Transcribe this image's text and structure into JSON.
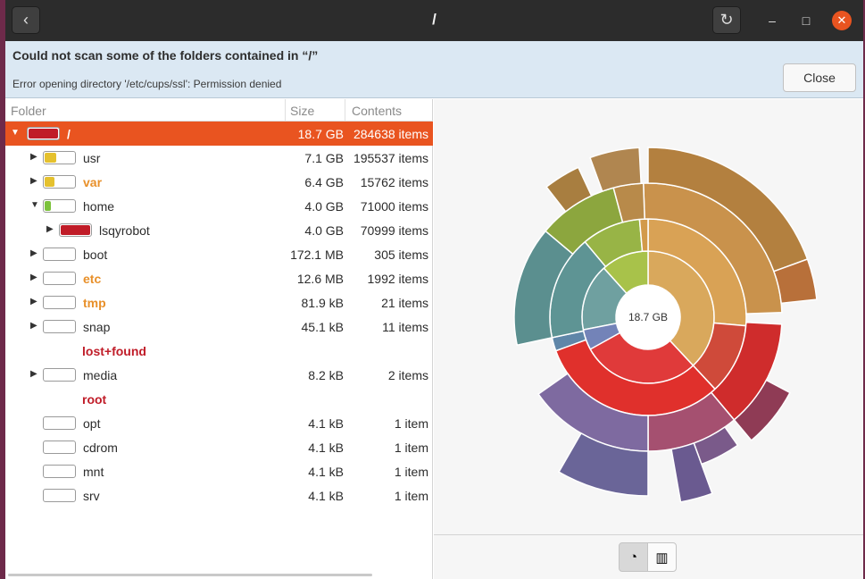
{
  "window": {
    "title": "/",
    "back_icon": "chevron-left-icon",
    "refresh_icon": "refresh-icon"
  },
  "infobar": {
    "title": "Could not scan some of the folders contained in “/”",
    "message": "Error opening directory '/etc/cups/ssl': Permission denied",
    "close_label": "Close"
  },
  "columns": {
    "folder": "Folder",
    "size": "Size",
    "contents": "Contents"
  },
  "rows": [
    {
      "name": "/",
      "size": "18.7 GB",
      "contents": "284638 items",
      "usage": 1.0,
      "color": "#c01c28"
    },
    {
      "name": "usr",
      "size": "7.1 GB",
      "contents": "195537 items",
      "usage": 0.38,
      "color": "#e5c12e"
    },
    {
      "name": "var",
      "size": "6.4 GB",
      "contents": "15762 items",
      "usage": 0.34,
      "color": "#e5c12e"
    },
    {
      "name": "home",
      "size": "4.0 GB",
      "contents": "71000 items",
      "usage": 0.21,
      "color": "#7cc23c"
    },
    {
      "name": "lsqyrobot",
      "size": "4.0 GB",
      "contents": "70999 items",
      "usage": 1.0,
      "color": "#c01c28"
    },
    {
      "name": "boot",
      "size": "172.1 MB",
      "contents": "305 items",
      "usage": 0.0,
      "color": "#7cc23c"
    },
    {
      "name": "etc",
      "size": "12.6 MB",
      "contents": "1992 items",
      "usage": 0.0,
      "color": "#7cc23c"
    },
    {
      "name": "tmp",
      "size": "81.9 kB",
      "contents": "21 items",
      "usage": 0.0,
      "color": "#7cc23c"
    },
    {
      "name": "snap",
      "size": "45.1 kB",
      "contents": "11 items",
      "usage": 0.0,
      "color": "#7cc23c"
    },
    {
      "name": "lost+found",
      "size": "",
      "contents": "",
      "usage": 0.0,
      "color": ""
    },
    {
      "name": "media",
      "size": "8.2 kB",
      "contents": "2 items",
      "usage": 0.0,
      "color": "#7cc23c"
    },
    {
      "name": "root",
      "size": "",
      "contents": "",
      "usage": 0.0,
      "color": ""
    },
    {
      "name": "opt",
      "size": "4.1 kB",
      "contents": "1 item",
      "usage": 0.0,
      "color": "#7cc23c"
    },
    {
      "name": "cdrom",
      "size": "4.1 kB",
      "contents": "1 item",
      "usage": 0.0,
      "color": "#7cc23c"
    },
    {
      "name": "mnt",
      "size": "4.1 kB",
      "contents": "1 item",
      "usage": 0.0,
      "color": "#7cc23c"
    },
    {
      "name": "srv",
      "size": "4.1 kB",
      "contents": "1 item",
      "usage": 0.0,
      "color": "#7cc23c"
    }
  ],
  "chart": {
    "center_label": "18.7 GB",
    "colors": {
      "usr": "#d9a85c",
      "var": "#a8c24a",
      "home": "#e03a3a",
      "other": "#6fa0a0",
      "blue": "#7383b8"
    }
  },
  "chart_toolbar": {
    "rings_icon": "rings-chart-icon",
    "treemap_icon": "treemap-chart-icon"
  }
}
